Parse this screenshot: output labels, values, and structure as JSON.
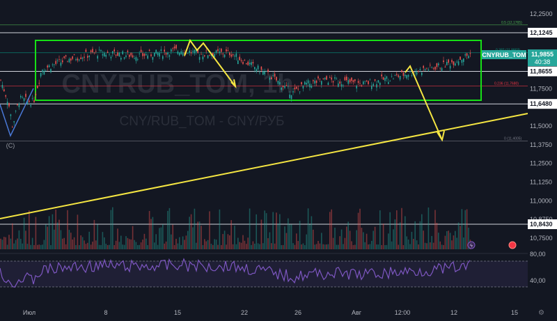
{
  "chart_data": {
    "type": "candlestick",
    "symbol": "CNYRUB_TOM",
    "watermark_symbol": "CNYRUB_TOM, 1h",
    "watermark_desc": "CNY/RUB_TOM - CNY/РУБ",
    "price_axis": {
      "ticks": [
        "12,2500",
        "12,1245",
        "11,9855",
        "11,8655",
        "11,7500",
        "11,6480",
        "11,5000",
        "11,3750",
        "11,2500",
        "11,1250",
        "11,0000",
        "10,8750",
        "10,8430",
        "10,7500"
      ]
    },
    "highlighted_prices": [
      {
        "label": "12,1245",
        "value": 12.1245
      },
      {
        "label": "11,8655",
        "value": 11.8655
      },
      {
        "label": "11,6480",
        "value": 11.648
      },
      {
        "label": "10,8430",
        "value": 10.843
      }
    ],
    "current_price": {
      "symbol": "CNYRUB_TOM",
      "value": "11,9855",
      "countdown": "40:38",
      "color": "#26a69a"
    },
    "fib_levels": [
      {
        "label": "0.5 (12,1765)",
        "value": 12.1765
      },
      {
        "label": "0.382 (11,9903)",
        "value": 11.9903
      },
      {
        "label": "0.236 (11,7680)",
        "value": 11.768
      },
      {
        "label": "0 (11,4005)",
        "value": 11.4005
      }
    ],
    "time_axis": [
      "Июл",
      "8",
      "15",
      "22",
      "26",
      "Авг",
      "12:00",
      "12",
      "15"
    ],
    "wave_label": "(C)",
    "rsi": {
      "ticks": [
        "80,00",
        "40,00"
      ],
      "upper": 70,
      "lower": 30
    },
    "colors": {
      "up": "#26a69a",
      "down": "#ef5350",
      "trendline": "#f5e642",
      "box": "#16e016",
      "rsi": "#7e57c2"
    }
  }
}
